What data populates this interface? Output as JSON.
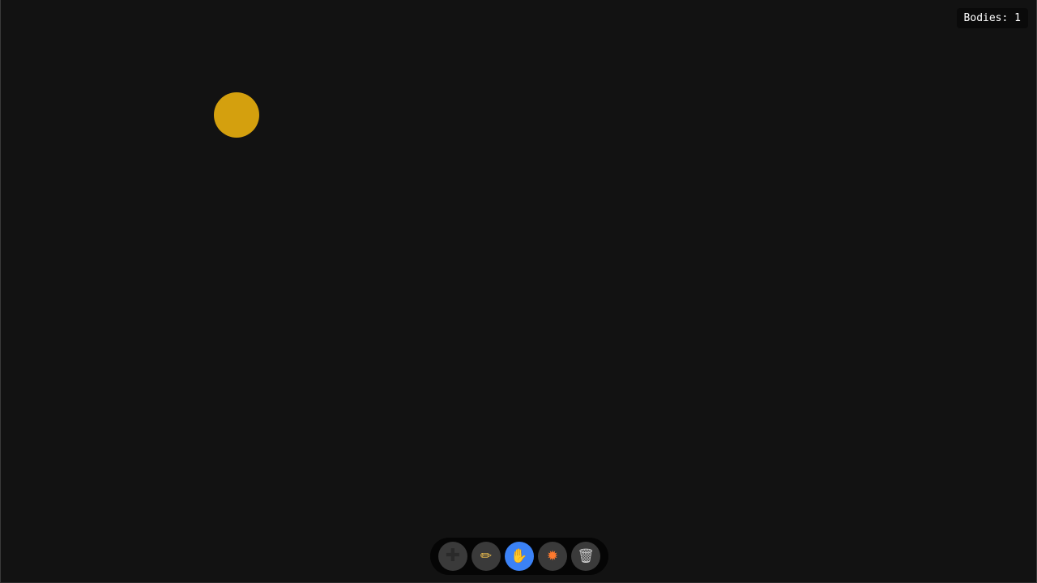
{
  "status": {
    "bodies_text": "Bodies: 1"
  },
  "bodies": [
    {
      "shape": "circle",
      "color": "#D4A00E"
    }
  ],
  "toolbar": {
    "tools": [
      {
        "id": "add",
        "icon_name": "plus-icon",
        "glyph": "✚",
        "active": false
      },
      {
        "id": "draw",
        "icon_name": "pencil-icon",
        "glyph": "✏",
        "active": false
      },
      {
        "id": "grab",
        "icon_name": "hand-icon",
        "glyph": "✋",
        "active": true
      },
      {
        "id": "explode",
        "icon_name": "explosion-icon",
        "glyph": "✹",
        "active": false
      },
      {
        "id": "clear",
        "icon_name": "trash-icon",
        "glyph": "🗑",
        "active": false
      }
    ]
  },
  "colors": {
    "background": "#121212",
    "active_tool": "#3B82F6",
    "tool_default": "#3A3A3A",
    "toolbar_bg": "#050505",
    "body": "#D4A00E"
  }
}
